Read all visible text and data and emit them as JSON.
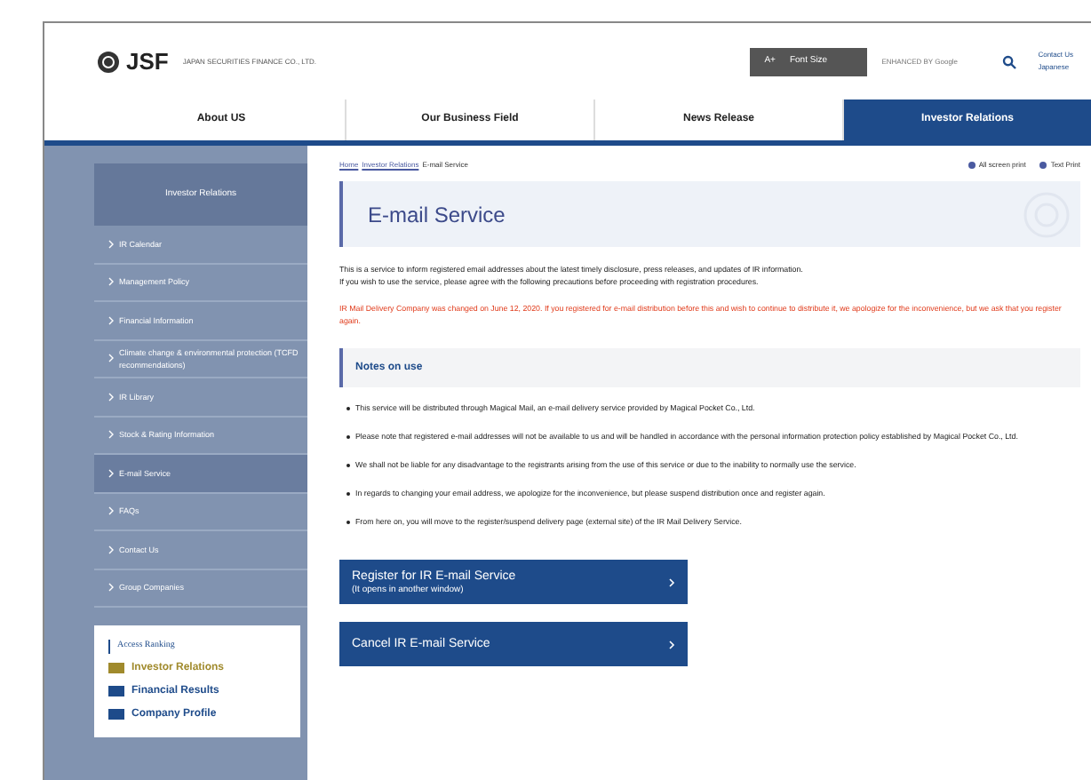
{
  "header": {
    "logo": "JSF",
    "company": "JAPAN SECURITIES FINANCE CO., LTD.",
    "font_size_button": {
      "icon": "A+",
      "label": "Font Size"
    },
    "search_placeholder": "ENHANCED BY Google",
    "links": [
      "Contact Us",
      "Japanese"
    ]
  },
  "nav": [
    {
      "label": "About US",
      "selected": false
    },
    {
      "label": "Our Business Field",
      "selected": false
    },
    {
      "label": "News Release",
      "selected": false
    },
    {
      "label": "Investor Relations",
      "selected": true
    }
  ],
  "sidebar": {
    "title": "Investor Relations",
    "items": [
      {
        "label": "IR Calendar",
        "selected": false
      },
      {
        "label": "Management Policy",
        "selected": false
      },
      {
        "label": "Financial Information",
        "selected": false
      },
      {
        "label": "Climate change & environmental protection (TCFD recommendations)",
        "selected": false
      },
      {
        "label": "IR Library",
        "selected": false
      },
      {
        "label": "Stock & Rating Information",
        "selected": false
      },
      {
        "label": "E-mail Service",
        "selected": true
      },
      {
        "label": "FAQs",
        "selected": false
      },
      {
        "label": "Contact Us",
        "selected": false
      },
      {
        "label": "Group Companies",
        "selected": false
      }
    ],
    "ranking": {
      "title": "Access Ranking",
      "items": [
        {
          "label": "Investor Relations",
          "color": "#a08a2c"
        },
        {
          "label": "Financial Results",
          "color": "#1e4b8a"
        },
        {
          "label": "Company Profile",
          "color": "#1e4b8a"
        }
      ]
    }
  },
  "breadcrumb": [
    "Home",
    "Investor Relations",
    "E-mail Service"
  ],
  "print_links": [
    "All screen print",
    "Text Print"
  ],
  "title": "E-mail Service",
  "intro": [
    "This is a service to inform registered email addresses about the latest timely disclosure, press releases, and updates of IR information.",
    "If you wish to use the service, please agree with the following precautions before proceeding with registration procedures."
  ],
  "notice": "IR Mail Delivery Company was changed on June 12, 2020. If you registered for e-mail distribution before this and wish to continue to distribute it, we apologize for the inconvenience, but we ask that you register again.",
  "notes": {
    "title": "Notes on use",
    "items": [
      "This service will be distributed through Magical Mail, an e-mail delivery service provided by Magical Pocket Co., Ltd.",
      "Please note that registered e-mail addresses will not be available to us and will be handled in accordance with the personal information protection policy established by Magical Pocket Co., Ltd.",
      "We shall not be liable for any disadvantage to the registrants arising from the use of this service or due to the inability to normally use the service.",
      "In regards to changing your email address, we apologize for the inconvenience, but please suspend distribution once and register again.",
      "From here on, you will move to the register/suspend delivery page (external site) of the IR Mail Delivery Service."
    ]
  },
  "buttons": [
    {
      "label": "Register for IR E-mail Service",
      "sub": "(It opens in another window)"
    },
    {
      "label": "Cancel IR E-mail Service"
    }
  ]
}
